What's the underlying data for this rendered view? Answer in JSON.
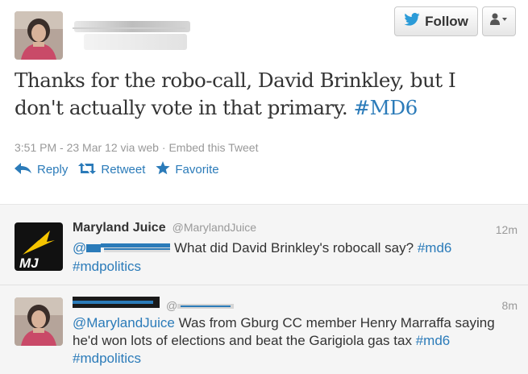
{
  "header": {
    "follow_label": "Follow"
  },
  "main_tweet": {
    "text_line1": "Thanks for the robo-call, David Brinkley, but I",
    "text_line2": "don't actually vote in that primary.",
    "hashtag": "#MD6",
    "timestamp": "3:51 PM - 23 Mar 12 via web",
    "separator": "·",
    "embed_label": "Embed this Tweet",
    "actions": {
      "reply": "Reply",
      "retweet": "Retweet",
      "favorite": "Favorite"
    }
  },
  "replies": [
    {
      "name": "Maryland Juice",
      "handle": "@MarylandJuice",
      "time": "12m",
      "mention_prefix": "@",
      "text_tail": " What did David Brinkley's robocall say?",
      "hashtag1": "#md6",
      "hashtag2": "#mdpolitics",
      "avatar_text": "MJ"
    },
    {
      "handle_prefix": "@",
      "time": "8m",
      "mention": "@MarylandJuice",
      "text1": " Was from Gburg CC member Henry Marraffa saying",
      "text2": "he'd won lots of elections and beat the Garigiola gas tax",
      "hashtag1": "#md6",
      "hashtag2": "#mdpolitics"
    }
  ],
  "colors": {
    "link": "#2b7bb9",
    "meta": "#999999",
    "text": "#333333",
    "reply_bg": "#f5f5f5",
    "mj_yellow": "#f5c400"
  }
}
